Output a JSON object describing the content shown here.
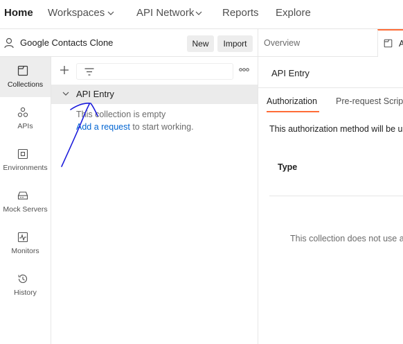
{
  "topnav": {
    "items": [
      {
        "label": "Home",
        "active": true,
        "dropdown": false
      },
      {
        "label": "Workspaces",
        "active": false,
        "dropdown": true
      },
      {
        "label": "API Network",
        "active": false,
        "dropdown": true
      },
      {
        "label": "Reports",
        "active": false,
        "dropdown": false
      },
      {
        "label": "Explore",
        "active": false,
        "dropdown": false
      }
    ]
  },
  "workspace": {
    "name": "Google Contacts Clone",
    "new_label": "New",
    "import_label": "Import"
  },
  "rail": {
    "items": [
      {
        "label": "Collections",
        "icon": "collections-icon",
        "active": true
      },
      {
        "label": "APIs",
        "icon": "apis-icon",
        "active": false
      },
      {
        "label": "Environments",
        "icon": "environments-icon",
        "active": false
      },
      {
        "label": "Mock Servers",
        "icon": "mock-servers-icon",
        "active": false
      },
      {
        "label": "Monitors",
        "icon": "monitors-icon",
        "active": false
      },
      {
        "label": "History",
        "icon": "history-icon",
        "active": false
      }
    ]
  },
  "collection": {
    "name": "API Entry",
    "empty_text": "This collection is empty",
    "add_link": "Add a request",
    "add_suffix": " to start working."
  },
  "right": {
    "tab_overview": "Overview",
    "tab_active_label": "A",
    "title": "API Entry",
    "subtab_auth": "Authorization",
    "subtab_pre": "Pre-request Scrip",
    "auth_desc": "This authorization method will be u",
    "type_label": "Type",
    "no_auth_text": "This collection does not use a"
  },
  "colors": {
    "accent": "#ff6c37",
    "link": "#0265d2",
    "annotation": "#1a1adb"
  }
}
